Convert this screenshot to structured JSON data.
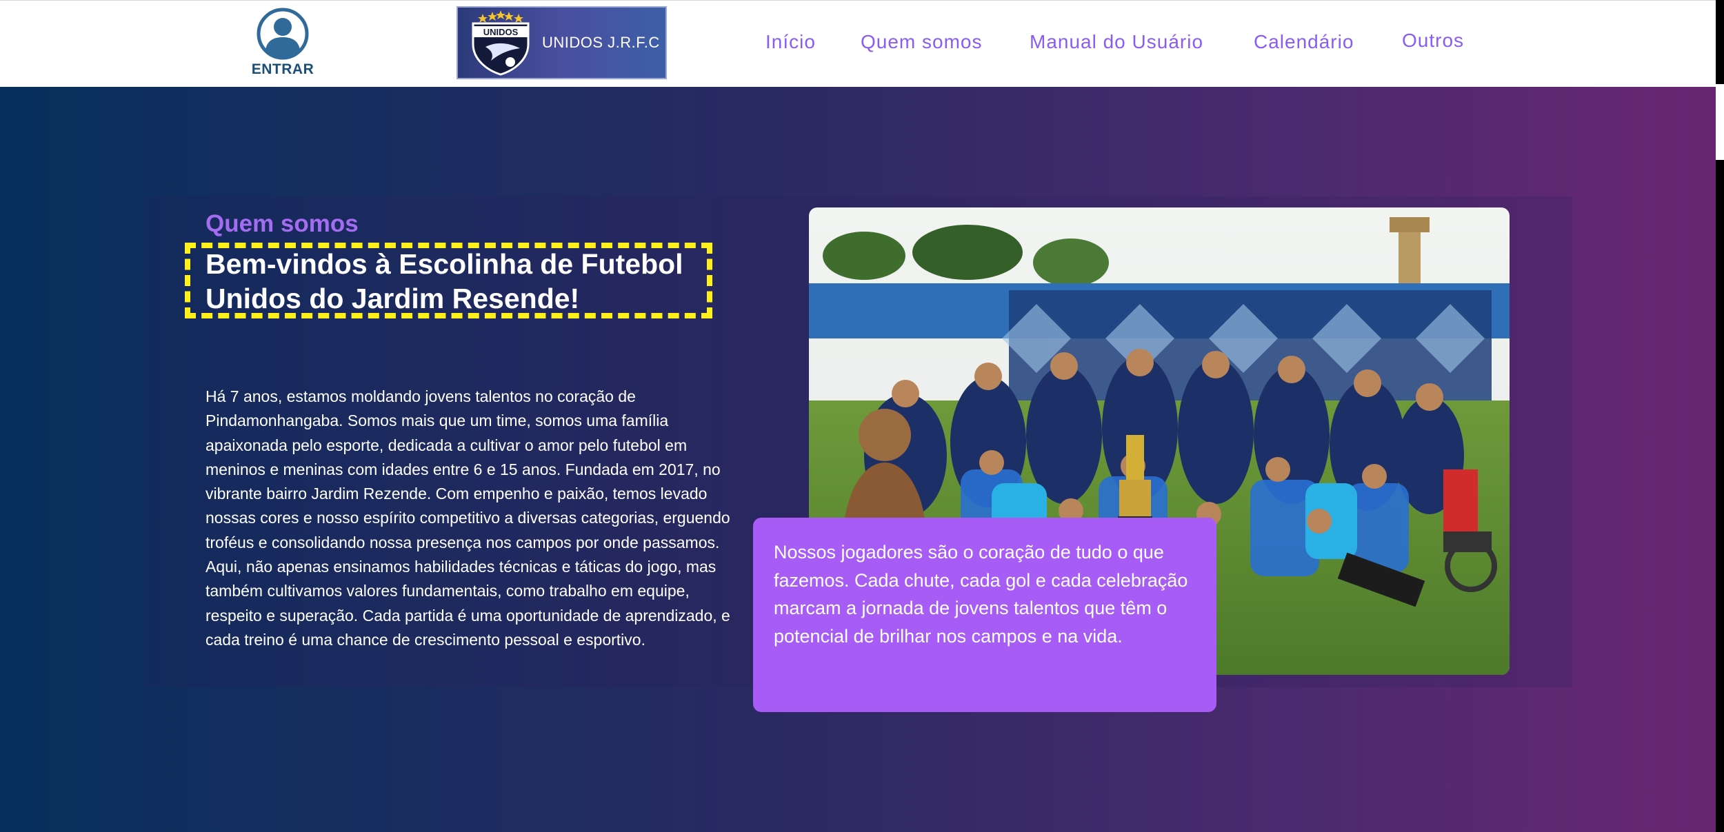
{
  "header": {
    "login_label": "ENTRAR",
    "logo_text": "UNIDOS J.R.F.C",
    "logo_badge_text": "UNIDOS"
  },
  "nav": [
    {
      "label": "Início"
    },
    {
      "label": "Quem somos"
    },
    {
      "label": "Manual do Usuário"
    },
    {
      "label": "Calendário"
    },
    {
      "label": "Outros"
    }
  ],
  "about": {
    "eyebrow": "Quem somos",
    "title": "Bem-vindos à Escolinha de Futebol Unidos do Jardim Resende!",
    "body": "Há 7 anos, estamos moldando jovens talentos no coração de Pindamonhangaba. Somos mais que um time, somos uma família apaixonada pelo esporte, dedicada a cultivar o amor pelo futebol em meninos e meninas com idades entre 6 e 15 anos. Fundada em 2017, no vibrante bairro Jardim Rezende. Com empenho e paixão, temos levado nossas cores e nosso espírito competitivo a diversas categorias, erguendo troféus e consolidando nossa presença nos campos por onde passamos. Aqui, não apenas ensinamos habilidades técnicas e táticas do jogo, mas também cultivamos valores fundamentais, como trabalho em equipe, respeito e superação. Cada partida é uma oportunidade de aprendizado, e cada treino é uma chance de crescimento pessoal e esportivo.",
    "caption": "Nossos jogadores são o coração de tudo o que fazemos. Cada chute, cada gol e cada celebração marcam a jornada de jovens talentos que têm o potencial de brilhar nos campos e na vida."
  },
  "colors": {
    "nav_link": "#8a5cf6",
    "accent_purple": "#a85cf6",
    "eyebrow": "#a46cf0",
    "title_border": "#ffef1a",
    "login_icon": "#2f6a9a"
  },
  "icons": {
    "login": "user-circle-icon",
    "logo": "team-crest-icon"
  }
}
